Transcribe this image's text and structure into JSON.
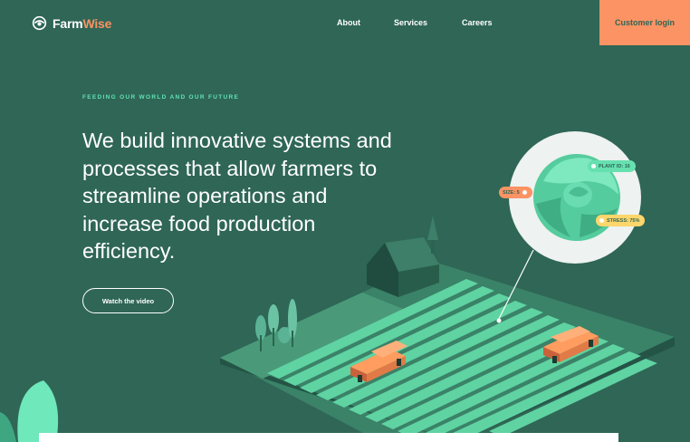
{
  "brand": {
    "name_part1": "Farm",
    "name_part2": "Wise",
    "logo_icon": "farmwise-logo-icon"
  },
  "nav": {
    "about": "About",
    "services": "Services",
    "careers": "Careers",
    "login": "Customer login"
  },
  "hero": {
    "eyebrow": "FEEDING OUR WORLD AND OUR FUTURE",
    "headline": "We build innovative systems and processes that allow farmers to streamline operations and increase food production efficiency.",
    "cta": "Watch the video"
  },
  "illustration": {
    "tags": {
      "plant_id": "PLANT ID: 16",
      "size": "SIZE: 5",
      "stress": "STRESS: 75%"
    }
  },
  "colors": {
    "background": "#2f6656",
    "accent_orange": "#fb9364",
    "accent_mint": "#5fe3b2",
    "accent_yellow": "#ffd66b"
  }
}
